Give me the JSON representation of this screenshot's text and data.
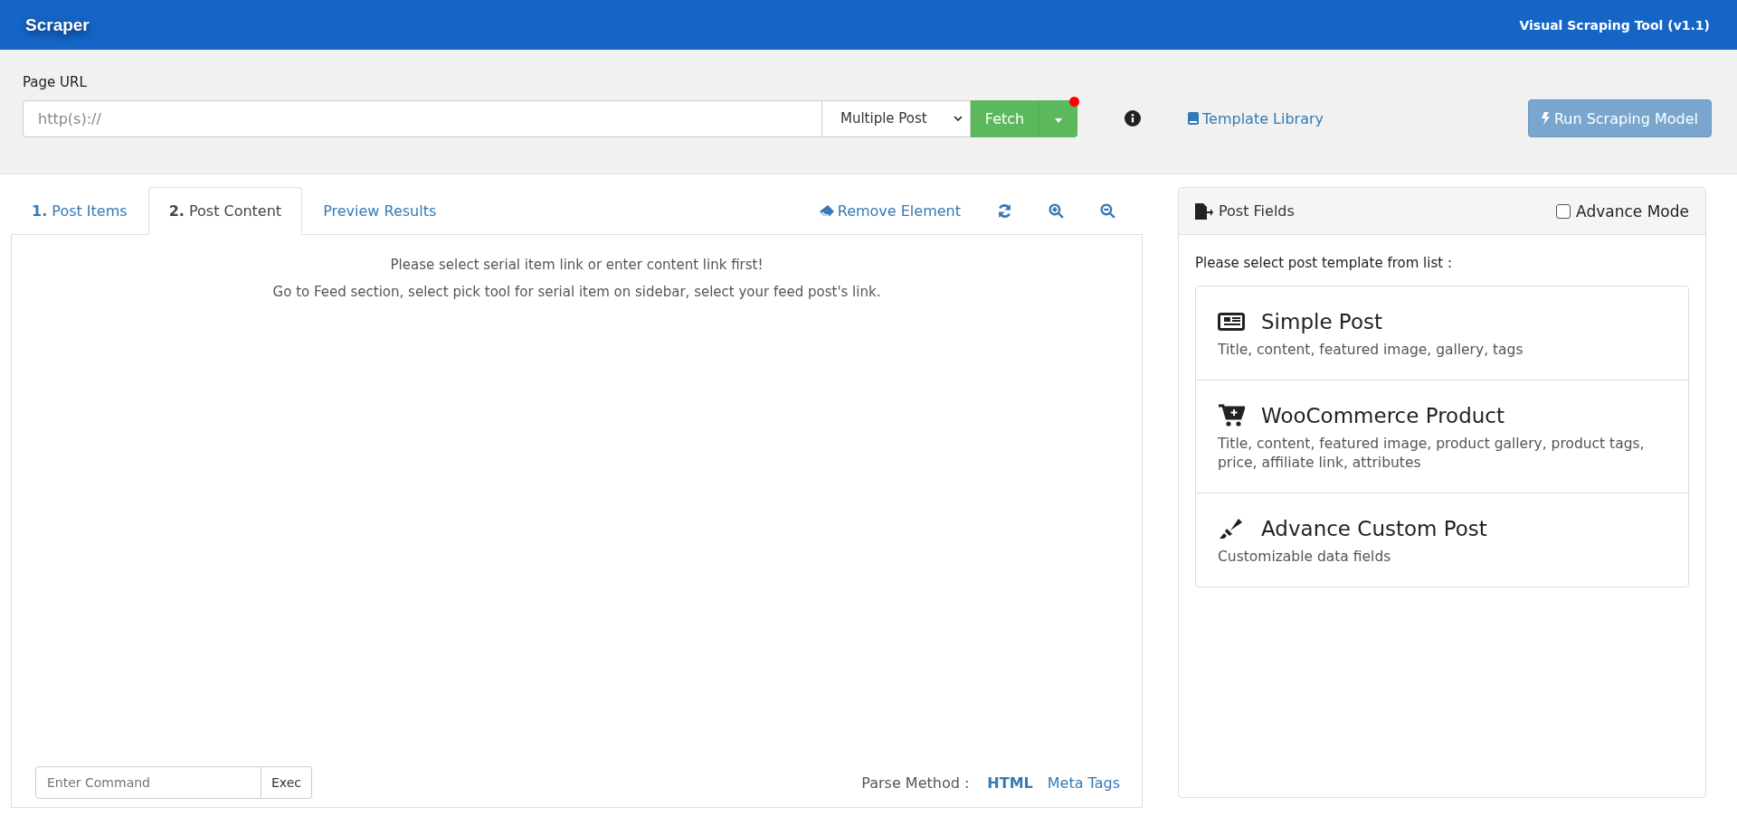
{
  "header": {
    "logo": "Scraper",
    "title": "Visual Scraping Tool (v1.1)"
  },
  "url_bar": {
    "label": "Page URL",
    "placeholder": "http(s)://",
    "mode": "Multiple Post",
    "fetch": "Fetch",
    "template_library": "Template Library",
    "run": "Run Scraping Model"
  },
  "tabs": [
    {
      "label": "**1.** Post Items",
      "selected": false
    },
    {
      "label": "**2.** Post Content",
      "selected": true
    },
    {
      "label": "Preview Results",
      "selected": false
    }
  ],
  "toolbar": {
    "remove": "Remove Element"
  },
  "content": {
    "messages": [
      "Please select serial item link or enter content link first!",
      "Go to Feed section, select pick tool for serial item on sidebar, select your feed post's link."
    ]
  },
  "command": {
    "placeholder": "Enter Command",
    "button": "Exec"
  },
  "parse": {
    "label": "Parse Method :",
    "options": [
      {
        "label": "HTML",
        "selected": true
      },
      {
        "label": "Meta Tags",
        "selected": false
      }
    ]
  },
  "post_fields": {
    "title": "Post Fields",
    "advance_mode": {
      "label": "Advance Mode",
      "checked": false
    },
    "prompt": "Please select post template from list :",
    "templates": [
      {
        "kind": "news",
        "title": "Simple Post",
        "desc": "Title, content, featured image, gallery, tags"
      },
      {
        "kind": "cart",
        "title": "WooCommerce Product",
        "desc": "Title, content, featured image, product gallery, product tags, price, affiliate link, attributes"
      },
      {
        "kind": "marker",
        "title": "Advance Custom Post",
        "desc": "Customizable data fields"
      }
    ]
  }
}
